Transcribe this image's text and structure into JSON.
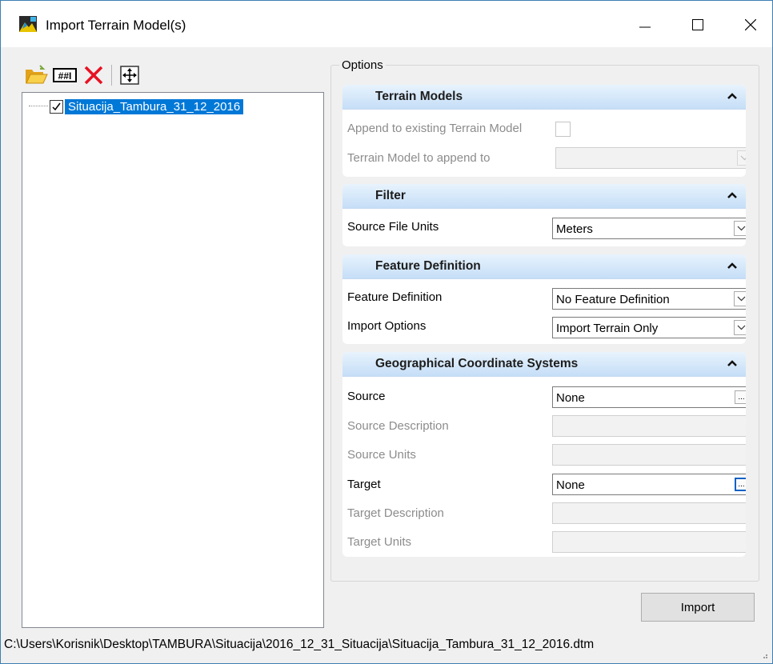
{
  "window": {
    "title": "Import Terrain Model(s)",
    "icon": "terrain-app-icon",
    "controls": [
      "minimize-icon",
      "maximize-icon",
      "close-icon"
    ]
  },
  "toolbar": {
    "buttons": [
      "open-folder-icon",
      "grid-number-icon",
      "delete-x-icon",
      "fit-view-icon"
    ]
  },
  "tree": {
    "items": [
      {
        "label": "Situacija_Tambura_31_12_2016",
        "checked": true,
        "selected": true
      }
    ]
  },
  "options": {
    "legend": "Options",
    "terrain_models": {
      "title": "Terrain Models",
      "append_label": "Append to existing Terrain Model",
      "append_checked": false,
      "append_to_label": "Terrain Model to append to",
      "append_to_value": ""
    },
    "filter": {
      "title": "Filter",
      "units_label": "Source File Units",
      "units_value": "Meters"
    },
    "feature_definition": {
      "title": "Feature Definition",
      "definition_label": "Feature Definition",
      "definition_value": "No Feature Definition",
      "import_options_label": "Import Options",
      "import_options_value": "Import Terrain Only"
    },
    "gcs": {
      "title": "Geographical Coordinate Systems",
      "source_label": "Source",
      "source_value": "None",
      "source_desc_label": "Source Description",
      "source_units_label": "Source Units",
      "target_label": "Target",
      "target_value": "None",
      "target_desc_label": "Target Description",
      "target_units_label": "Target Units",
      "browse_label": "..."
    }
  },
  "import_button": "Import",
  "status_path": "C:\\Users\\Korisnik\\Desktop\\TAMBURA\\Situacija\\2016_12_31_Situacija\\Situacija_Tambura_31_12_2016.dtm",
  "colors": {
    "selection": "#0078d7",
    "section_header": "#c5def7",
    "delete": "#e81123"
  }
}
